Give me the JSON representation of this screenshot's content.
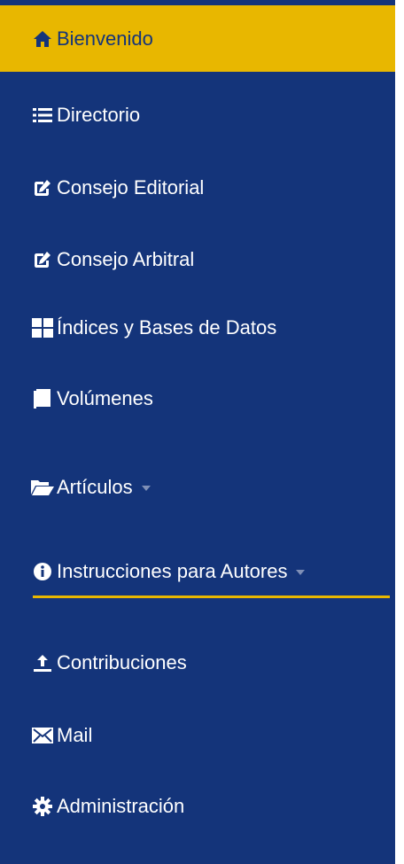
{
  "sidebar": {
    "colors": {
      "background": "#14347a",
      "active_background": "#e8b700",
      "active_text": "#14347a",
      "text": "#ffffff",
      "underline": "#e8b700"
    },
    "items": [
      {
        "label": "Bienvenido",
        "icon": "home-icon",
        "active": true
      },
      {
        "label": "Directorio",
        "icon": "list-icon",
        "active": false
      },
      {
        "label": "Consejo Editorial",
        "icon": "edit-icon",
        "active": false
      },
      {
        "label": "Consejo Arbitral",
        "icon": "edit-icon",
        "active": false
      },
      {
        "label": "Índices y Bases de Datos",
        "icon": "grid-icon",
        "active": false
      },
      {
        "label": "Volúmenes",
        "icon": "book-icon",
        "active": false
      },
      {
        "label": "Artículos",
        "icon": "folder-open-icon",
        "active": false,
        "dropdown": true
      },
      {
        "label": "Instrucciones para Autores",
        "icon": "info-icon",
        "active": false,
        "dropdown": true,
        "underlined": true
      },
      {
        "label": "Contribuciones",
        "icon": "upload-icon",
        "active": false
      },
      {
        "label": "Mail",
        "icon": "mail-icon",
        "active": false
      },
      {
        "label": "Administración",
        "icon": "gear-icon",
        "active": false
      }
    ]
  }
}
